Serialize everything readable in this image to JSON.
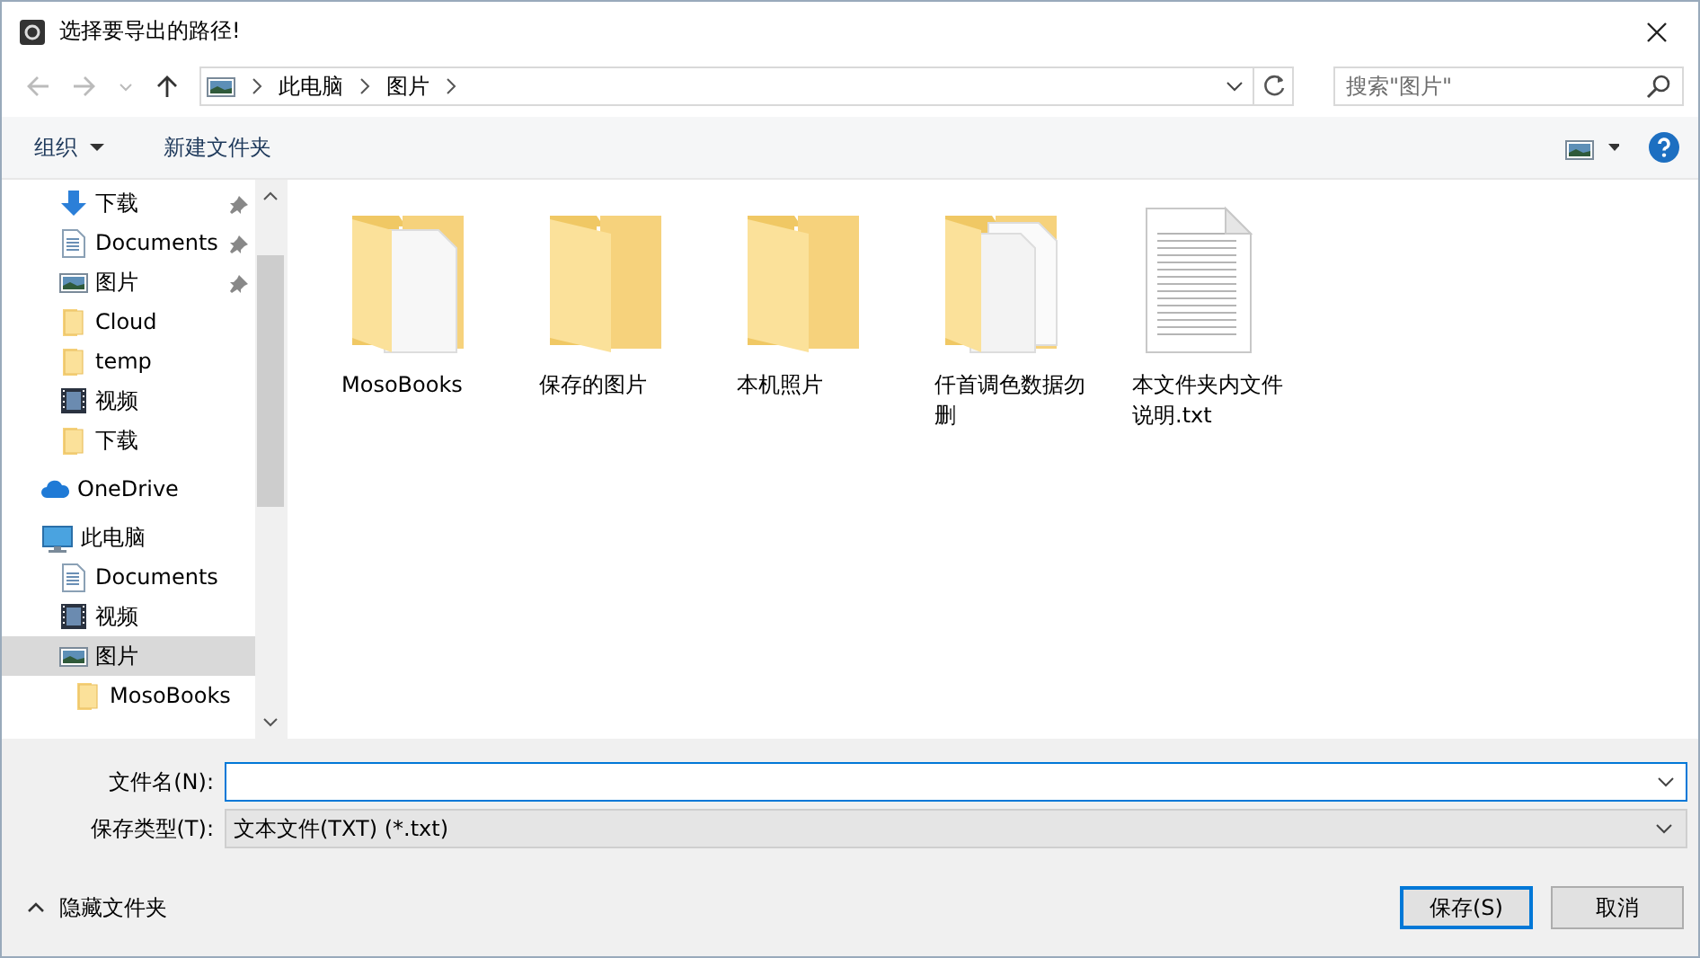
{
  "window": {
    "title": "选择要导出的路径!"
  },
  "address": {
    "crumbs": [
      "此电脑",
      "图片"
    ]
  },
  "search": {
    "placeholder": "搜索\"图片\""
  },
  "toolbar": {
    "organize": "组织",
    "new_folder": "新建文件夹"
  },
  "sidebar": {
    "items": [
      {
        "label": "下载",
        "kind": "download",
        "pinned": true,
        "selected": false
      },
      {
        "label": "Documents",
        "kind": "document",
        "pinned": true,
        "selected": false
      },
      {
        "label": "图片",
        "kind": "picture",
        "pinned": true,
        "selected": false
      },
      {
        "label": "Cloud",
        "kind": "folder",
        "pinned": false,
        "selected": false
      },
      {
        "label": "temp",
        "kind": "folder",
        "pinned": false,
        "selected": false
      },
      {
        "label": "视频",
        "kind": "video",
        "pinned": false,
        "selected": false
      },
      {
        "label": "下载",
        "kind": "folder",
        "pinned": false,
        "selected": false
      },
      {
        "label": "OneDrive",
        "kind": "cloud",
        "pinned": false,
        "selected": false
      },
      {
        "label": "此电脑",
        "kind": "pc",
        "pinned": false,
        "selected": false,
        "children": [
          {
            "label": "Documents",
            "kind": "document",
            "pinned": false,
            "selected": false
          },
          {
            "label": "视频",
            "kind": "video",
            "pinned": false,
            "selected": false
          },
          {
            "label": "图片",
            "kind": "picture",
            "pinned": false,
            "selected": true,
            "children": [
              {
                "label": "MosoBooks",
                "kind": "folder",
                "pinned": false,
                "selected": false
              }
            ]
          }
        ]
      }
    ]
  },
  "files": [
    {
      "name": "MosoBooks",
      "kind": "folder-doc"
    },
    {
      "name": "保存的图片",
      "kind": "folder"
    },
    {
      "name": "本机照片",
      "kind": "folder"
    },
    {
      "name": "仟首调色数据勿删",
      "kind": "folder-docs"
    },
    {
      "name": "本文件夹内文件说明.txt",
      "kind": "text-file"
    }
  ],
  "form": {
    "filename_label": "文件名(N):",
    "type_label": "保存类型(T):",
    "type_value": "文本文件(TXT) (*.txt)"
  },
  "footer": {
    "hide_folders": "隐藏文件夹",
    "buttons": [
      {
        "label": "保存(S)",
        "default": true
      },
      {
        "label": "取消",
        "default": false
      }
    ]
  }
}
